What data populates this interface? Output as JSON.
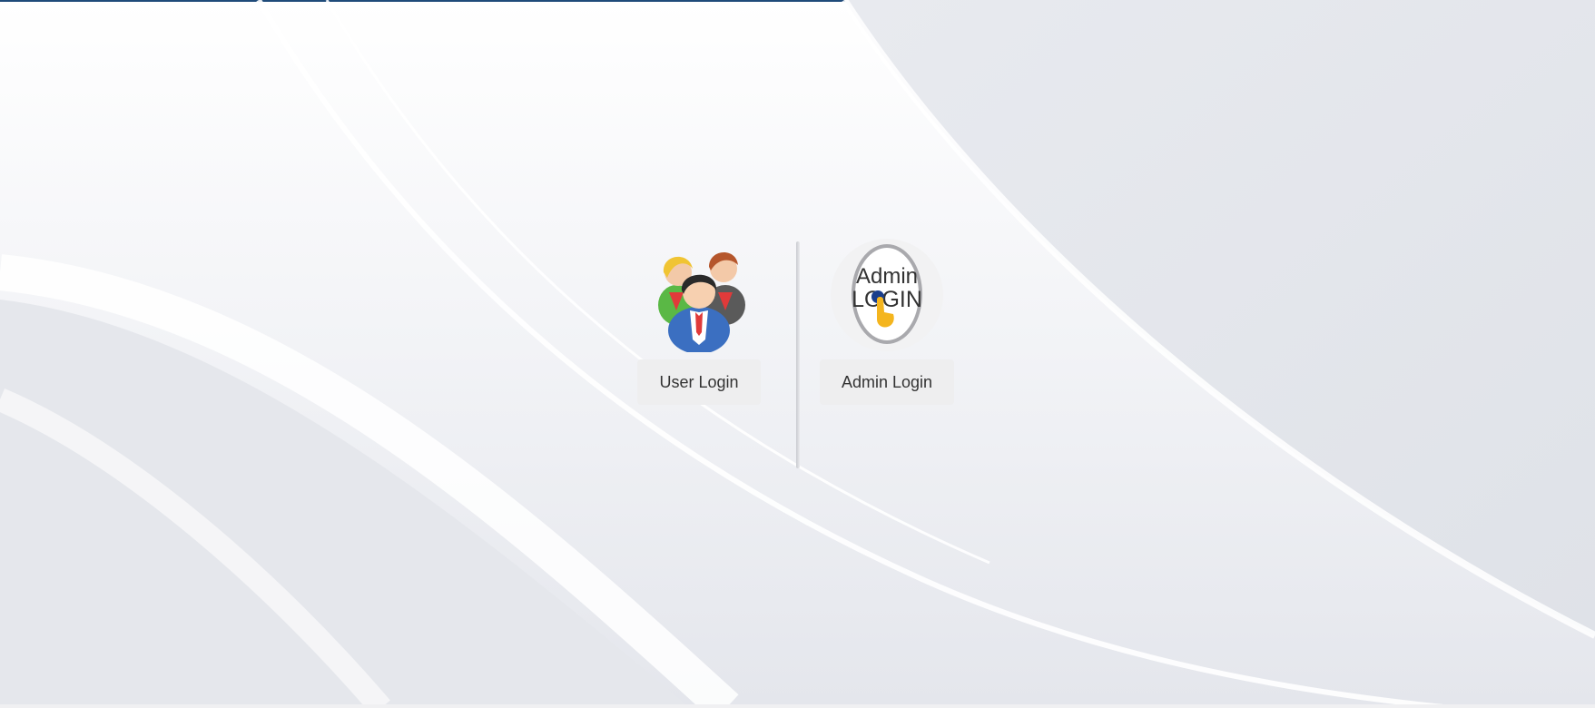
{
  "background": {
    "top_rule_color": "#1f4b7a"
  },
  "user_login": {
    "icon": "users-group-icon",
    "label": "User Login"
  },
  "admin_login": {
    "icon": "admin-login-badge-icon",
    "badge_line1": "Admin",
    "badge_line2": "LOGIN",
    "label": "Admin Login"
  }
}
